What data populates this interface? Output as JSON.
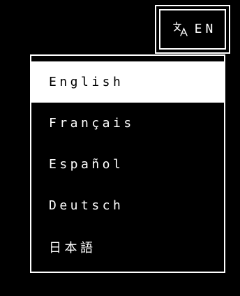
{
  "language_toggle": {
    "icon": "translate-icon",
    "code": "EN"
  },
  "language_menu": {
    "items": [
      {
        "label": "English",
        "selected": true
      },
      {
        "label": "Français",
        "selected": false
      },
      {
        "label": "Español",
        "selected": false
      },
      {
        "label": "Deutsch",
        "selected": false
      },
      {
        "label": "日本語",
        "selected": false
      }
    ]
  },
  "colors": {
    "background": "#000000",
    "foreground": "#ffffff",
    "selected_text": "#000000"
  }
}
